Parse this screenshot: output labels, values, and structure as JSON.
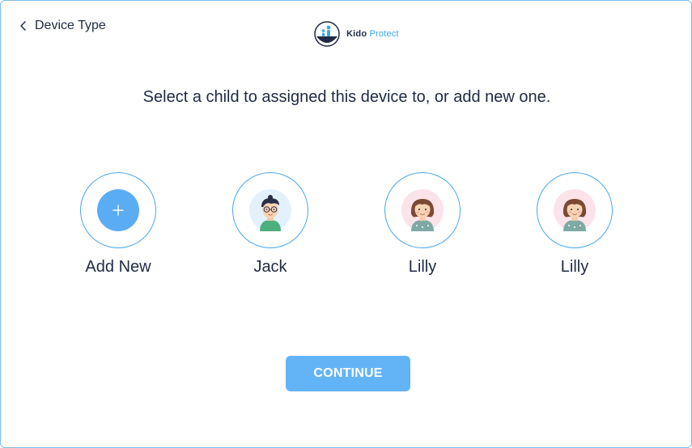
{
  "header": {
    "back_label": "Device Type",
    "logo": {
      "brand_primary": "Kido",
      "brand_secondary": "Protect"
    }
  },
  "main": {
    "headline": "Select a child to assigned this device to, or add new one.",
    "add_new": {
      "label": "Add New",
      "icon": "plus-icon"
    },
    "children": [
      {
        "name": "Jack",
        "avatar": "boy-avatar"
      },
      {
        "name": "Lilly",
        "avatar": "girl-avatar"
      },
      {
        "name": "Lilly",
        "avatar": "girl-avatar"
      }
    ],
    "continue_label": "CONTINUE"
  },
  "colors": {
    "accent": "#5aadf3",
    "button": "#63b4f7",
    "ring": "#4aa8ea",
    "text": "#1f2a44"
  }
}
